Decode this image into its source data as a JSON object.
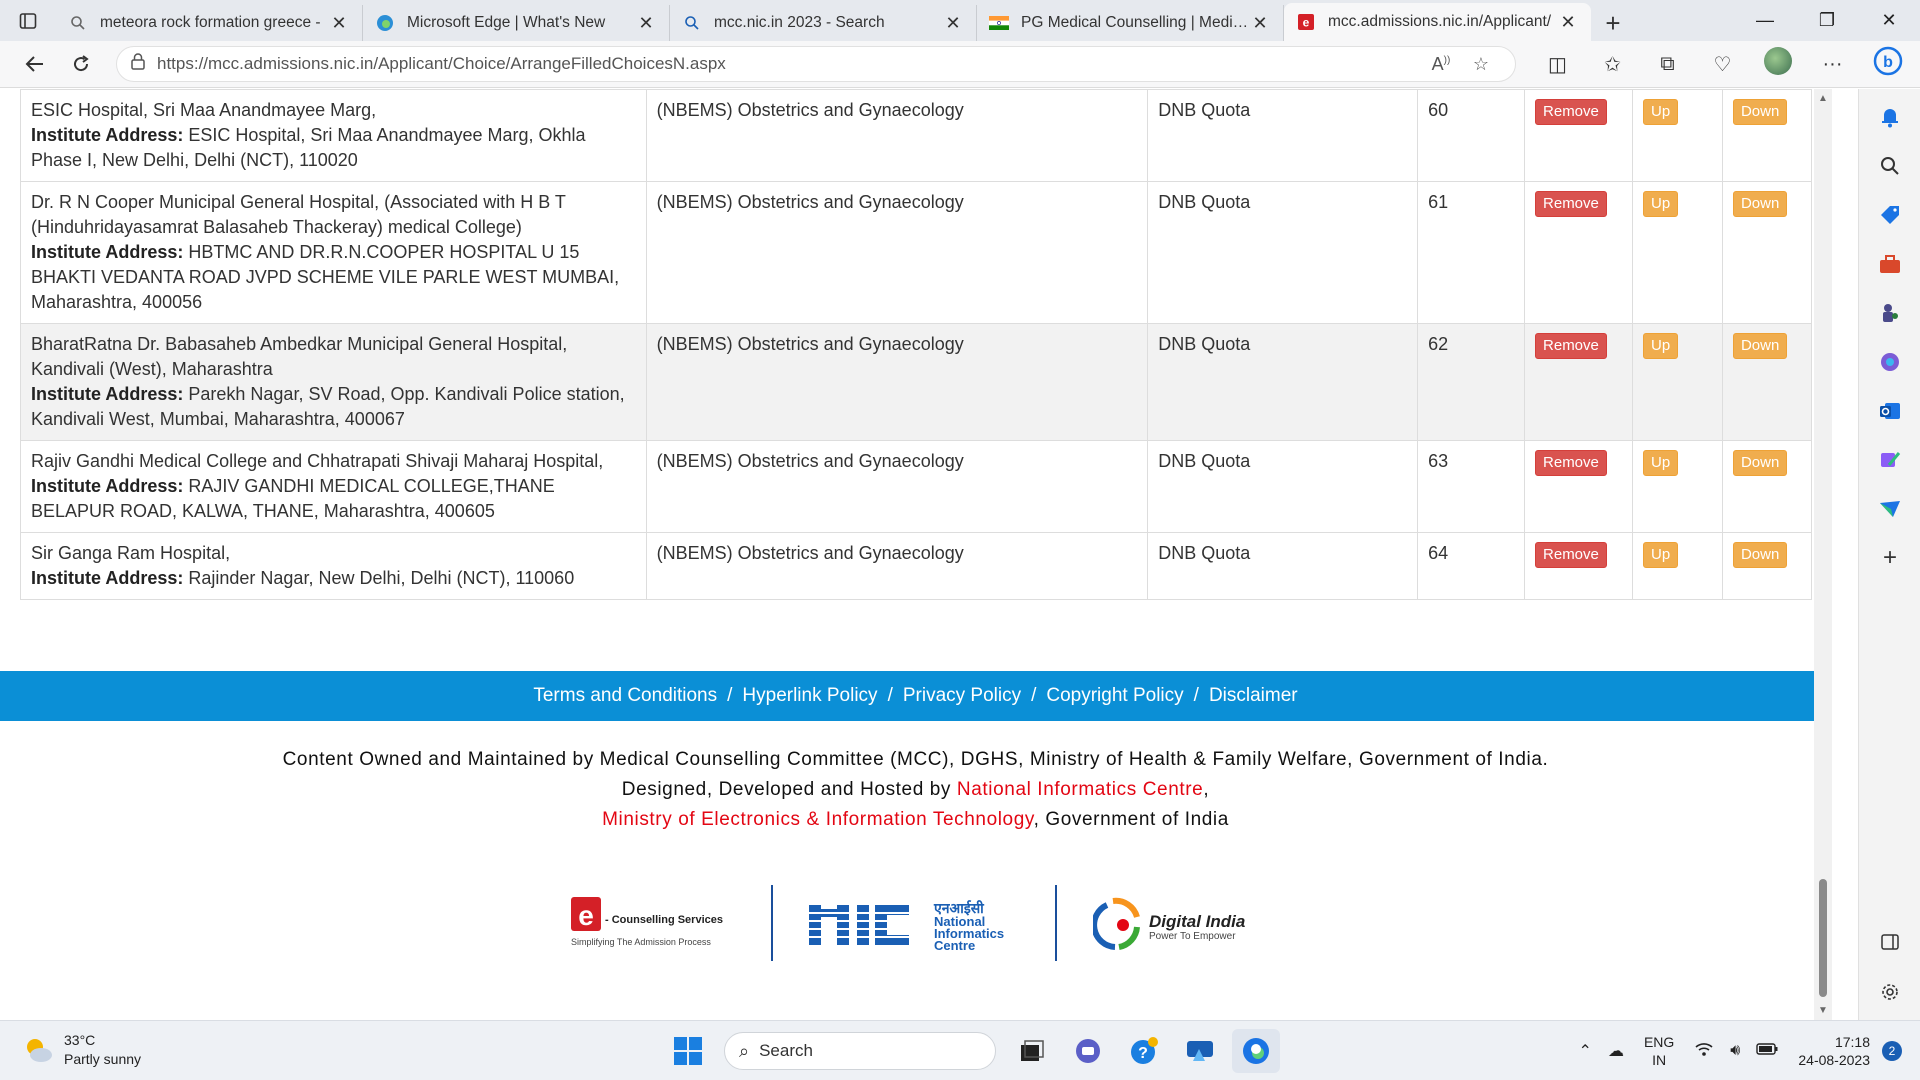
{
  "browser": {
    "tabs": [
      {
        "title": "meteora rock formation greece -",
        "icon": "search-icon"
      },
      {
        "title": "Microsoft Edge | What's New",
        "icon": "edge-icon"
      },
      {
        "title": "mcc.nic.in 2023 - Search",
        "icon": "search-icon"
      },
      {
        "title": "PG Medical Counselling | Medica",
        "icon": "india-flag-icon"
      },
      {
        "title": "mcc.admissions.nic.in/Applicant/",
        "icon": "ecounselling-icon"
      }
    ],
    "active_tab_index": 4,
    "url": "https://mcc.admissions.nic.in/Applicant/Choice/ArrangeFilledChoicesN.aspx"
  },
  "choices": {
    "rows": [
      {
        "institute_name": "ESIC Hospital, Sri Maa Anandmayee Marg,",
        "address_label": "Institute Address:",
        "address": "ESIC Hospital, Sri Maa Anandmayee Marg, Okhla Phase I, New Delhi, Delhi (NCT), 110020",
        "course": "(NBEMS) Obstetrics and Gynaecology",
        "quota": "DNB Quota",
        "choice_no": "60",
        "remove": "Remove",
        "up": "Up",
        "down": "Down"
      },
      {
        "institute_name": "Dr. R N Cooper Municipal General Hospital, (Associated with H B T (Hinduhridayasamrat Balasaheb Thackeray) medical College)",
        "address_label": "Institute Address:",
        "address": "HBTMC AND DR.R.N.COOPER HOSPITAL U 15 BHAKTI VEDANTA ROAD JVPD SCHEME VILE PARLE WEST MUMBAI, Maharashtra, 400056",
        "course": "(NBEMS) Obstetrics and Gynaecology",
        "quota": "DNB Quota",
        "choice_no": "61",
        "remove": "Remove",
        "up": "Up",
        "down": "Down"
      },
      {
        "institute_name": "BharatRatna Dr. Babasaheb Ambedkar Municipal General Hospital, Kandivali (West), Maharashtra",
        "address_label": "Institute Address:",
        "address": "Parekh Nagar, SV Road, Opp. Kandivali Police station, Kandivali West, Mumbai, Maharashtra, 400067",
        "course": "(NBEMS) Obstetrics and Gynaecology",
        "quota": "DNB Quota",
        "choice_no": "62",
        "remove": "Remove",
        "up": "Up",
        "down": "Down"
      },
      {
        "institute_name": "Rajiv Gandhi Medical College and Chhatrapati Shivaji Maharaj Hospital,",
        "address_label": "Institute Address:",
        "address": "RAJIV GANDHI MEDICAL COLLEGE,THANE BELAPUR ROAD, KALWA, THANE, Maharashtra, 400605",
        "course": "(NBEMS) Obstetrics and Gynaecology",
        "quota": "DNB Quota",
        "choice_no": "63",
        "remove": "Remove",
        "up": "Up",
        "down": "Down"
      },
      {
        "institute_name": "Sir Ganga Ram Hospital,",
        "address_label": "Institute Address:",
        "address": "Rajinder Nagar, New Delhi, Delhi (NCT), 110060",
        "course": "(NBEMS) Obstetrics and Gynaecology",
        "quota": "DNB Quota",
        "choice_no": "64",
        "remove": "Remove",
        "up": "Up",
        "down": "Down"
      }
    ]
  },
  "footer": {
    "links": [
      "Terms and Conditions",
      "Hyperlink Policy",
      "Privacy Policy",
      "Copyright Policy",
      "Disclaimer"
    ],
    "separator": "/",
    "line1": "Content Owned and Maintained by Medical Counselling Committee (MCC), DGHS, Ministry of Health & Family Welfare, Government of India.",
    "line2_prefix": "Designed, Developed and Hosted by ",
    "line2_link": "National Informatics Centre",
    "line2_suffix": ",",
    "line3_link": "Ministry of Electronics & Information Technology",
    "line3_suffix": ", Government of India",
    "logos": {
      "ecounselling_title": "- Counselling Services",
      "ecounselling_tagline": "Simplifying The Admission Process",
      "nic_hindi": "एनआईसी",
      "nic_line1": "National",
      "nic_line2": "Informatics",
      "nic_line3": "Centre",
      "di_title": "Digital India",
      "di_tagline": "Power To Empower"
    }
  },
  "taskbar": {
    "weather_temp": "33°C",
    "weather_desc": "Partly sunny",
    "search_placeholder": "Search",
    "lang_line1": "ENG",
    "lang_line2": "IN",
    "time": "17:18",
    "date": "24-08-2023",
    "notification_count": "2"
  },
  "colors": {
    "footer_bar": "#0b8fd6",
    "remove_button": "#d9534f",
    "up_down_button": "#f0ad4e",
    "footer_link_red": "#e30613"
  }
}
